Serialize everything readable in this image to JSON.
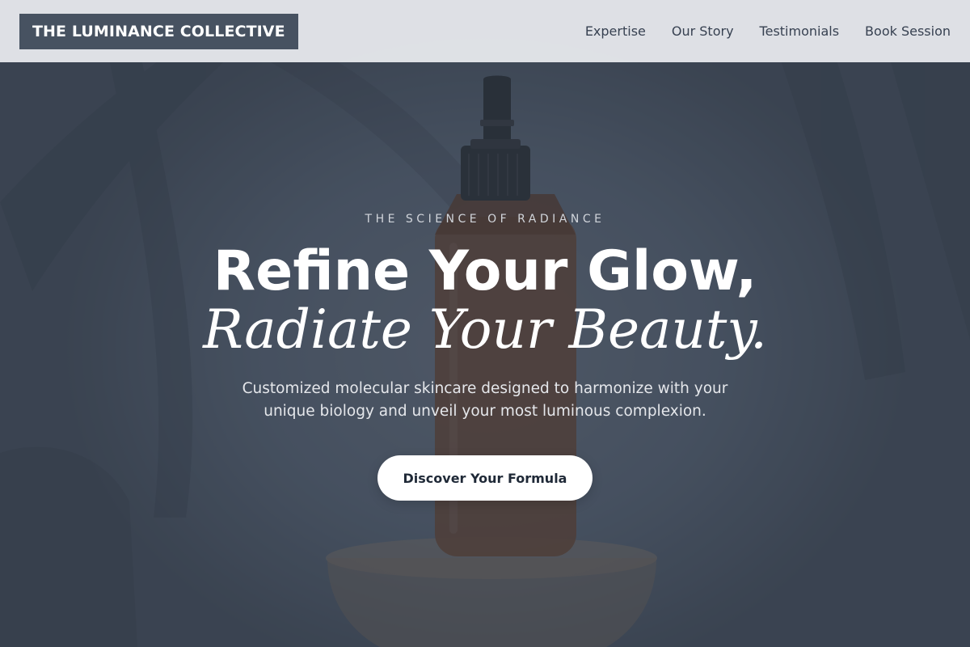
{
  "header": {
    "logo_text": "THE LUMINANCE COLLECTIVE",
    "nav": [
      {
        "label": "Expertise"
      },
      {
        "label": "Our Story"
      },
      {
        "label": "Testimonials"
      },
      {
        "label": "Book Session"
      }
    ]
  },
  "hero": {
    "eyebrow": "THE SCIENCE OF RADIANCE",
    "headline_line1": "Refine Your Glow,",
    "headline_line2": "Radiate Your Beauty.",
    "subtext": "Customized molecular skincare designed to harmonize with your unique biology and unveil your most luminous complexion.",
    "cta_label": "Discover Your Formula",
    "image_subject": "amber-dropper-bottle-on-pedestal"
  },
  "colors": {
    "header_bg": "#e5e7eb",
    "logo_bg": "#475261",
    "overlay": "#374151",
    "cta_bg": "#ffffff",
    "cta_text": "#1f2937",
    "bottle_amber": "#6b3a1c"
  }
}
